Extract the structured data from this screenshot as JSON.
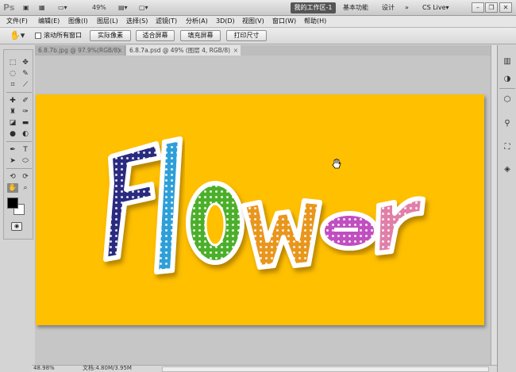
{
  "app": {
    "logo": "Ps",
    "zoom_display": "49%",
    "workspace_active": "我的工作区-1",
    "workspace_basic": "基本功能",
    "workspace_design": "设计",
    "more_glyph": "»",
    "cs_live": "CS Live▾"
  },
  "menu": {
    "items": [
      "文件(F)",
      "编辑(E)",
      "图像(I)",
      "图层(L)",
      "选择(S)",
      "滤镜(T)",
      "分析(A)",
      "3D(D)",
      "视图(V)",
      "窗口(W)",
      "帮助(H)"
    ]
  },
  "options": {
    "scroll_all_windows": "滚动所有窗口",
    "actual_pixels": "实际像素",
    "fit_screen": "适合屏幕",
    "fill_screen": "填充屏幕",
    "print_size": "打印尺寸"
  },
  "tabs": [
    {
      "label": "6.8.7b.jpg @ 97.9%(RGB/8)"
    },
    {
      "label": "6.8.7a.psd @ 49% (图层 4, RGB/8)"
    }
  ],
  "artwork": {
    "text": "Flower",
    "background_color": "#ffc000",
    "letter_colors": [
      "#2a2a80",
      "#2e9fd8",
      "#4caf2a",
      "#e8961c",
      "#c04fc0",
      "#e07fa8"
    ]
  },
  "status": {
    "zoom": "48.98%",
    "doc": "文档:4.80M/3.95M"
  },
  "colors": {
    "foreground": "#000000",
    "background": "#ffffff"
  }
}
